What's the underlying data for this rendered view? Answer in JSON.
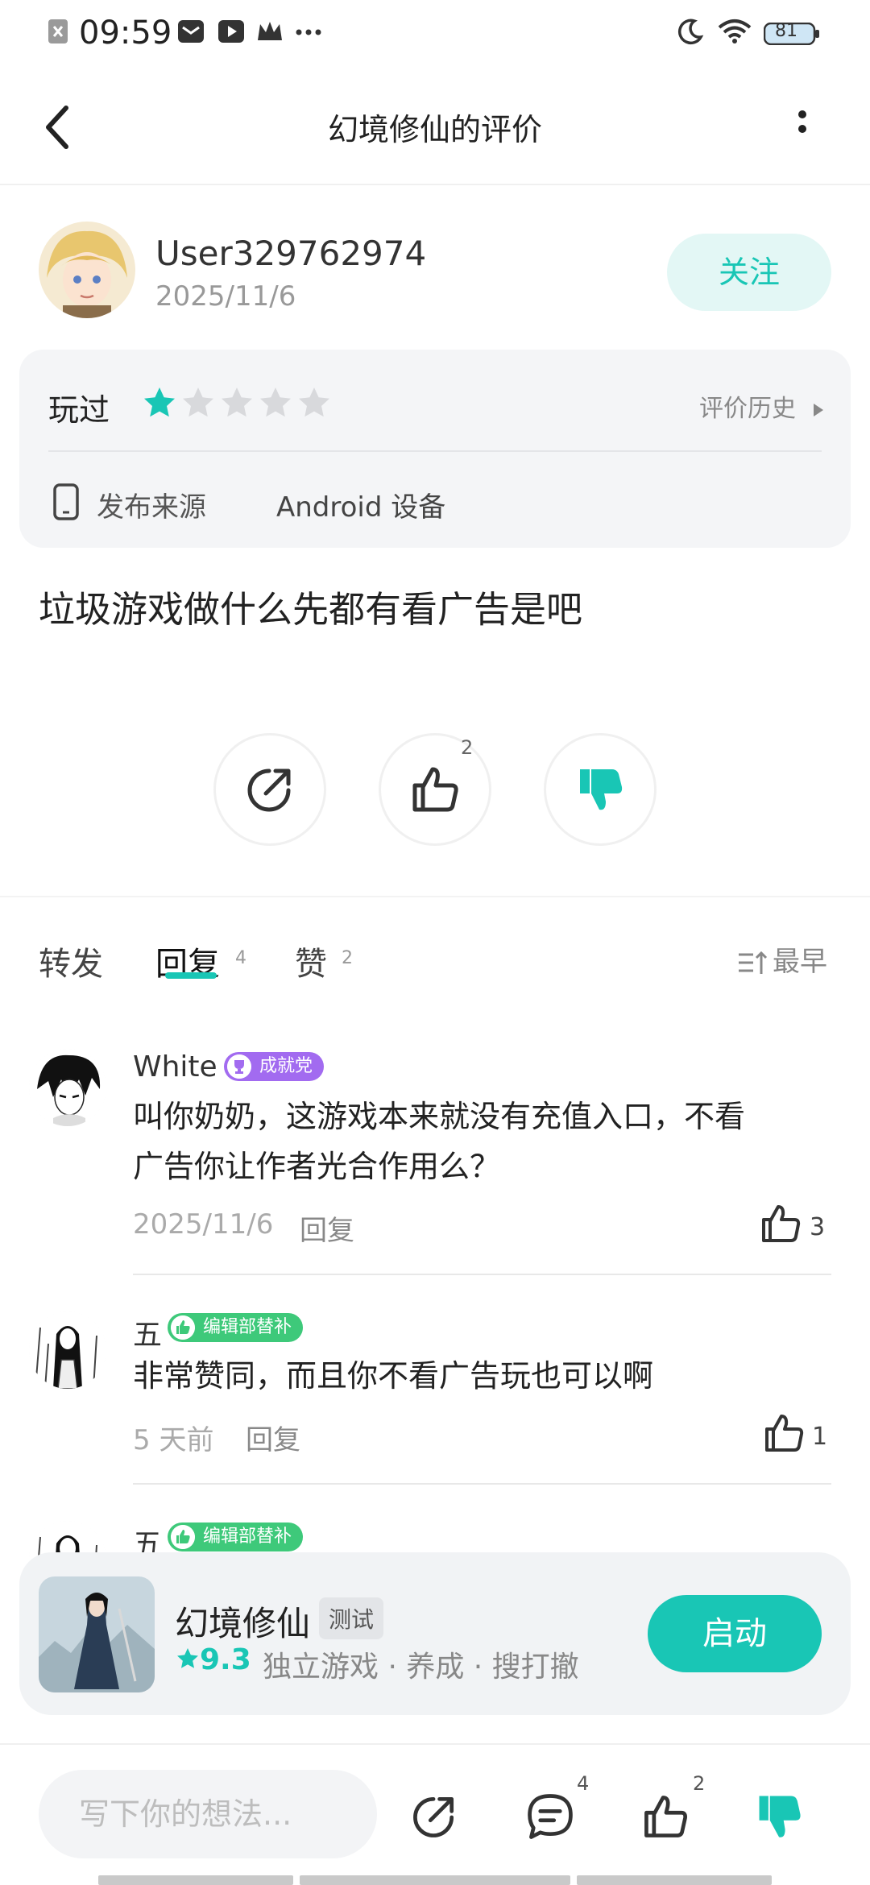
{
  "status_bar": {
    "time": "09:59",
    "battery": "81",
    "icons": [
      "close-box-icon",
      "mail-icon",
      "play-icon",
      "crown-icon",
      "more-dots-icon",
      "moon-icon",
      "wifi-icon",
      "battery-icon"
    ]
  },
  "header": {
    "title": "幻境修仙的评价",
    "back_icon": "chevron-left-icon",
    "more_icon": "vertical-dots-icon"
  },
  "review": {
    "username": "User329762974",
    "date": "2025/11/6",
    "follow_label": "关注",
    "played_label": "玩过",
    "rating": 1,
    "rating_max": 5,
    "history_label": "评价历史",
    "source_label": "发布来源",
    "source_value": "Android 设备",
    "text": "垃圾游戏做什么先都有看广告是吧",
    "like_count": "2"
  },
  "tabs": {
    "items": [
      {
        "label": "转发",
        "count": ""
      },
      {
        "label": "回复",
        "count": "4"
      },
      {
        "label": "赞",
        "count": "2"
      }
    ],
    "active": 1,
    "sort_label": "最早"
  },
  "comments": [
    {
      "name": "White",
      "badge": "成就党",
      "badge_color": "#a26bf0",
      "text_line1": "叫你奶奶，这游戏本来就没有充值入口，不看",
      "text_line2": "广告你让作者光合作用么？",
      "time": "2025/11/6",
      "reply_label": "回复",
      "likes": "3"
    },
    {
      "name": "五",
      "badge": "编辑部替补",
      "badge_color": "#3ec97a",
      "text_line1": "非常赞同，而且你不看广告玩也可以啊",
      "time": "5 天前",
      "reply_label": "回复",
      "likes": "1"
    },
    {
      "name": "五",
      "badge": "编辑部替补",
      "badge_color": "#3ec97a"
    }
  ],
  "game_card": {
    "name": "幻境修仙",
    "tag": "测试",
    "score": "9.3",
    "categories": "独立游戏 · 养成 · 搜打撤",
    "launch_label": "启动"
  },
  "bottom_bar": {
    "input_placeholder": "写下你的想法...",
    "comment_count": "4",
    "like_count": "2"
  },
  "colors": {
    "accent": "#19c6b5",
    "star_empty": "#d8d9dc"
  }
}
